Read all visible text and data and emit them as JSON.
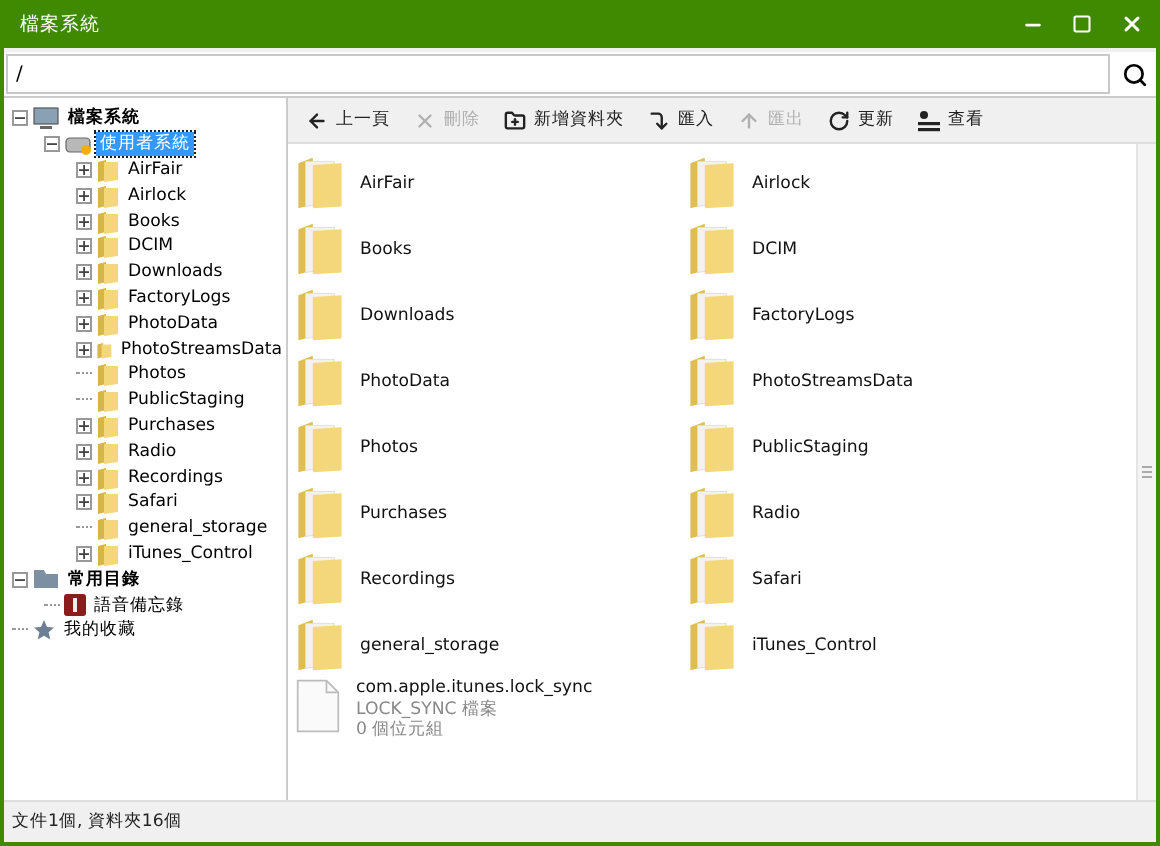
{
  "window": {
    "title": "檔案系統"
  },
  "address": {
    "value": "/"
  },
  "tree": [
    {
      "label": "檔案系統",
      "kind": "computer",
      "expanded": true,
      "selected": false,
      "children": [
        {
          "label": "使用者系統",
          "kind": "drive",
          "expanded": true,
          "selected": true,
          "children": [
            {
              "label": "AirFair",
              "kind": "folder",
              "expandable": true,
              "selected": false
            },
            {
              "label": "Airlock",
              "kind": "folder",
              "expandable": true,
              "selected": false
            },
            {
              "label": "Books",
              "kind": "folder",
              "expandable": true,
              "selected": false
            },
            {
              "label": "DCIM",
              "kind": "folder",
              "expandable": true,
              "selected": false
            },
            {
              "label": "Downloads",
              "kind": "folder",
              "expandable": true,
              "selected": false
            },
            {
              "label": "FactoryLogs",
              "kind": "folder",
              "expandable": true,
              "selected": false
            },
            {
              "label": "PhotoData",
              "kind": "folder",
              "expandable": true,
              "selected": false
            },
            {
              "label": "PhotoStreamsData",
              "kind": "folder",
              "expandable": true,
              "selected": false
            },
            {
              "label": "Photos",
              "kind": "folder",
              "expandable": false,
              "selected": false
            },
            {
              "label": "PublicStaging",
              "kind": "folder",
              "expandable": false,
              "selected": false
            },
            {
              "label": "Purchases",
              "kind": "folder",
              "expandable": true,
              "selected": false
            },
            {
              "label": "Radio",
              "kind": "folder",
              "expandable": true,
              "selected": false
            },
            {
              "label": "Recordings",
              "kind": "folder",
              "expandable": true,
              "selected": false
            },
            {
              "label": "Safari",
              "kind": "folder",
              "expandable": true,
              "selected": false
            },
            {
              "label": "general_storage",
              "kind": "folder",
              "expandable": false,
              "selected": false
            },
            {
              "label": "iTunes_Control",
              "kind": "folder",
              "expandable": true,
              "selected": false
            }
          ]
        }
      ]
    },
    {
      "label": "常用目錄",
      "kind": "shelf",
      "expanded": true,
      "selected": false,
      "children": [
        {
          "label": "語音備忘錄",
          "kind": "memo",
          "expandable": false,
          "selected": false
        }
      ]
    },
    {
      "label": "我的收藏",
      "kind": "star",
      "expandable": false,
      "selected": false
    }
  ],
  "toolbar": [
    {
      "label": "上一頁",
      "kind": "back",
      "disabled": false
    },
    {
      "label": "刪除",
      "kind": "delete",
      "disabled": true
    },
    {
      "label": "新增資料夾",
      "kind": "new-folder",
      "disabled": false
    },
    {
      "label": "匯入",
      "kind": "import",
      "disabled": false
    },
    {
      "label": "匯出",
      "kind": "export",
      "disabled": true
    },
    {
      "label": "更新",
      "kind": "refresh",
      "disabled": false
    },
    {
      "label": "查看",
      "kind": "view",
      "disabled": false
    }
  ],
  "items": [
    {
      "name": "AirFair",
      "kind": "folder"
    },
    {
      "name": "Airlock",
      "kind": "folder"
    },
    {
      "name": "Books",
      "kind": "folder"
    },
    {
      "name": "DCIM",
      "kind": "folder"
    },
    {
      "name": "Downloads",
      "kind": "folder"
    },
    {
      "name": "FactoryLogs",
      "kind": "folder"
    },
    {
      "name": "PhotoData",
      "kind": "folder"
    },
    {
      "name": "PhotoStreamsData",
      "kind": "folder"
    },
    {
      "name": "Photos",
      "kind": "folder"
    },
    {
      "name": "PublicStaging",
      "kind": "folder"
    },
    {
      "name": "Purchases",
      "kind": "folder"
    },
    {
      "name": "Radio",
      "kind": "folder"
    },
    {
      "name": "Recordings",
      "kind": "folder"
    },
    {
      "name": "Safari",
      "kind": "folder"
    },
    {
      "name": "general_storage",
      "kind": "folder"
    },
    {
      "name": "iTunes_Control",
      "kind": "folder"
    },
    {
      "name": "com.apple.itunes.lock_sync",
      "kind": "file",
      "type": "LOCK_SYNC 檔案",
      "size": "0 個位元組"
    }
  ],
  "status_bar": "文件1個, 資料夾16個"
}
